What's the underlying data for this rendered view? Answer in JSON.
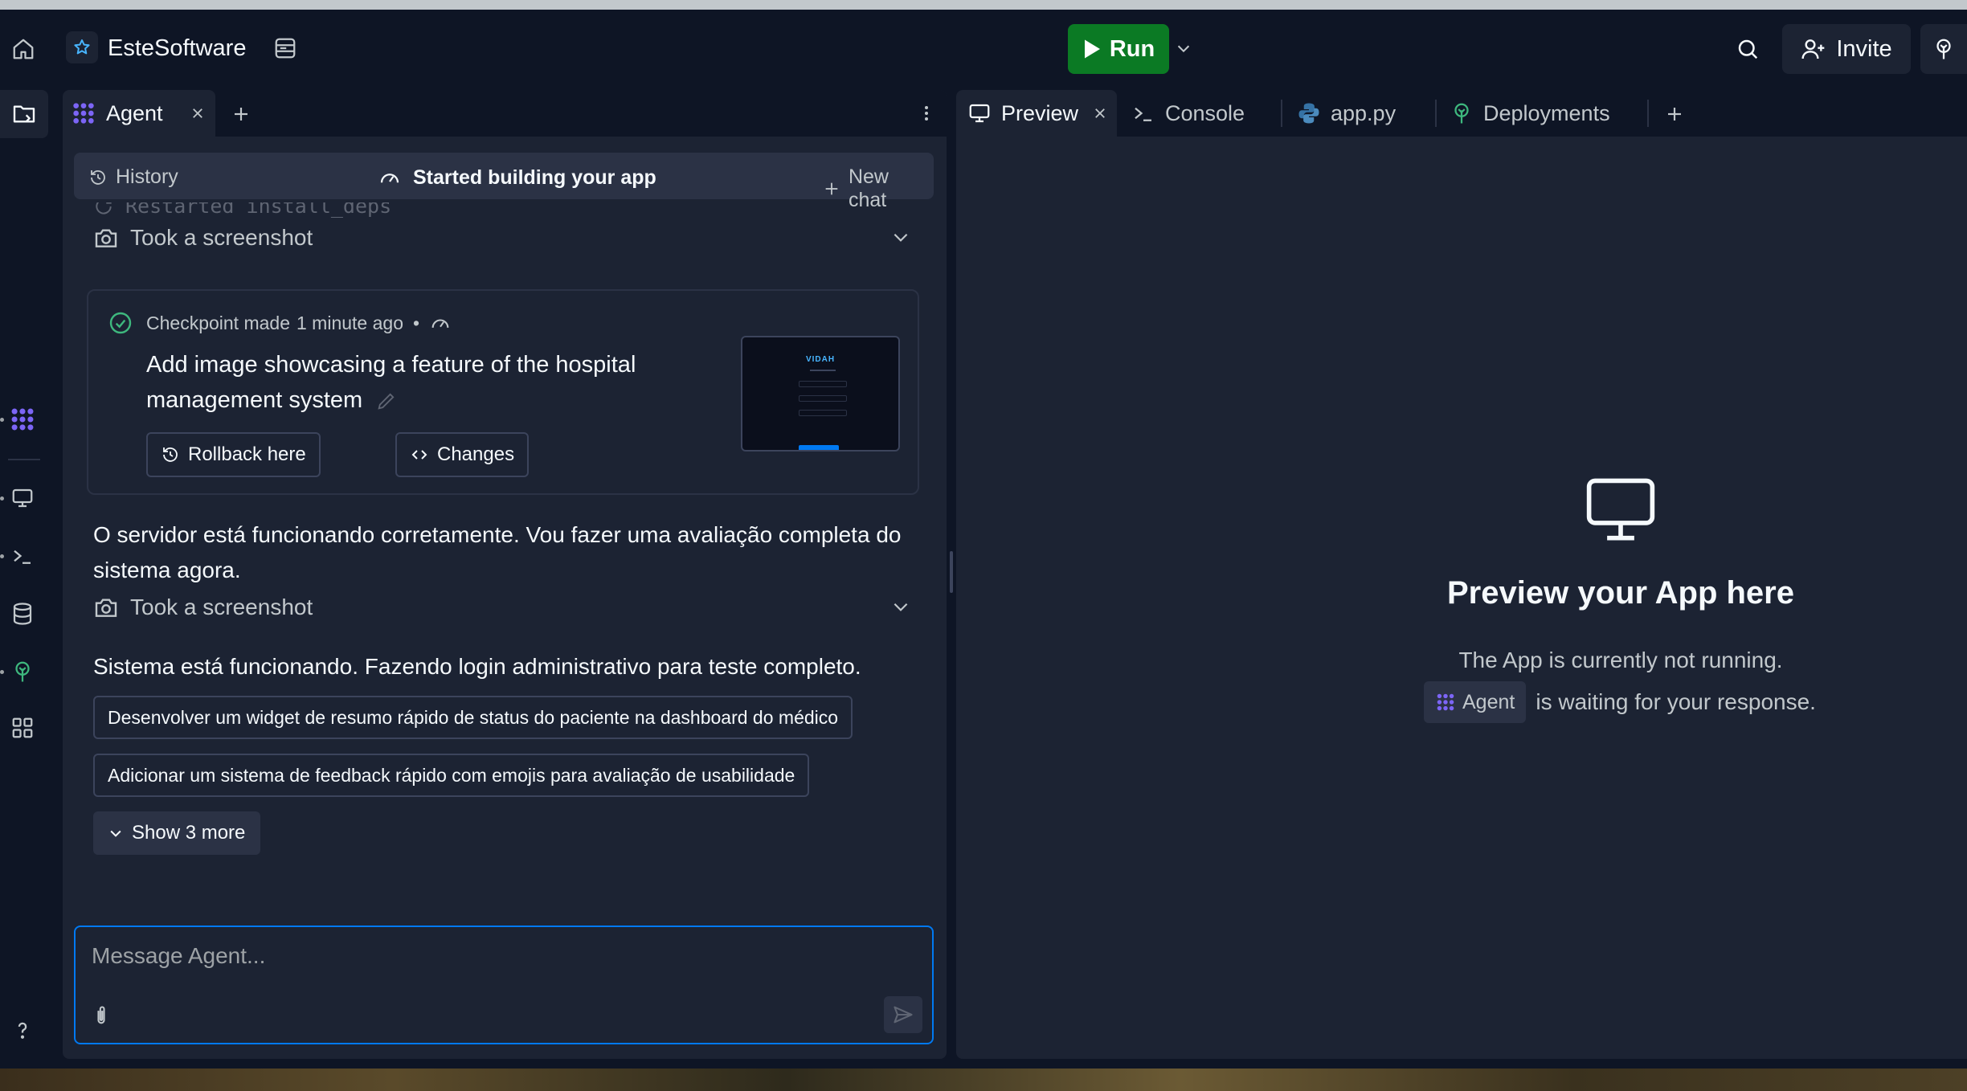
{
  "header": {
    "project_name": "EsteSoftware",
    "run_label": "Run",
    "invite_label": "Invite",
    "run_color": "#0b7a24"
  },
  "rail": {
    "items": [
      {
        "name": "files",
        "icon": "files-icon"
      },
      {
        "name": "agent",
        "icon": "agent-icon"
      },
      {
        "name": "preview",
        "icon": "monitor-icon"
      },
      {
        "name": "console",
        "icon": "terminal-icon"
      },
      {
        "name": "database",
        "icon": "database-icon"
      },
      {
        "name": "deployments",
        "icon": "deploy-icon"
      },
      {
        "name": "all-tools",
        "icon": "grid-icon"
      },
      {
        "name": "help",
        "icon": "help-icon"
      }
    ]
  },
  "agent_panel": {
    "tab_label": "Agent",
    "history_label": "History",
    "chat_title": "Started building your app",
    "new_chat_label": "New chat",
    "faded_action": "Restarted install_deps",
    "action_1": "Took a screenshot",
    "checkpoint": {
      "meta_prefix": "Checkpoint made",
      "meta_time": "1 minute ago",
      "meta_sep": "•",
      "title": "Add image showcasing a feature of the hospital management system",
      "rollback_label": "Rollback here",
      "changes_label": "Changes",
      "thumbnail_title": "VIDAH"
    },
    "message_1": "O servidor está funcionando corretamente. Vou fazer uma avaliação completa do sistema agora.",
    "action_2": "Took a screenshot",
    "message_2": "Sistema está funcionando. Fazendo login administrativo para teste completo.",
    "suggestions": [
      "Desenvolver um widget de resumo rápido de status do paciente na dashboard do médico",
      "Adicionar um sistema de feedback rápido com emojis para avaliação de usabilidade"
    ],
    "show_more_label": "Show 3 more",
    "input_placeholder": "Message Agent..."
  },
  "right_panel": {
    "tabs": [
      {
        "label": "Preview",
        "icon": "monitor-icon",
        "active": true
      },
      {
        "label": "Console",
        "icon": "terminal-icon",
        "active": false
      },
      {
        "label": "app.py",
        "icon": "python-icon",
        "active": false
      },
      {
        "label": "Deployments",
        "icon": "deploy-icon",
        "active": false
      }
    ],
    "empty_title": "Preview your App here",
    "empty_line1": "The App is currently not running.",
    "empty_chip": "Agent",
    "empty_line2": "is waiting for your response."
  },
  "colors": {
    "background": "#0e1525",
    "panel": "#1c2333",
    "border": "#2b3245",
    "accent_blue": "#0079f2",
    "agent_purple": "#7c65f6",
    "deploy_green": "#3eb87e"
  }
}
